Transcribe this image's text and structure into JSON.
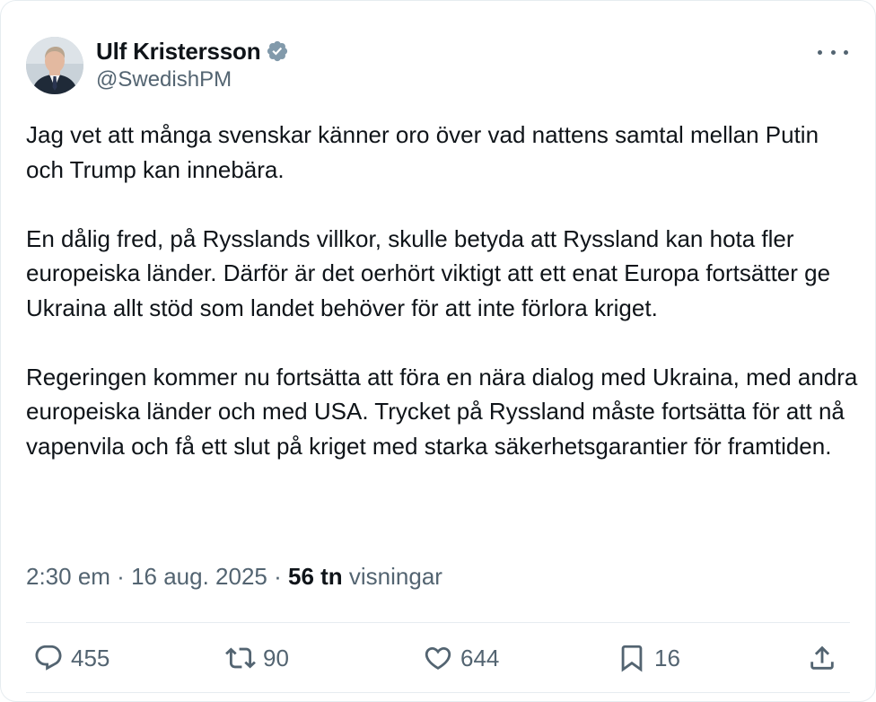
{
  "author": {
    "display_name": "Ulf Kristersson",
    "handle": "@SwedishPM",
    "verified_badge": "verified-badge-icon",
    "verified_color": "#829aab"
  },
  "tweet": {
    "paragraphs": [
      "Jag vet att många svenskar känner oro över vad nattens samtal mellan Putin och Trump kan innebära.",
      "En dålig fred, på Rysslands villkor, skulle betyda att Ryssland kan hota fler europeiska länder. Därför är det oerhört viktigt att ett enat Europa fortsätter ge Ukraina allt stöd som landet behöver för att inte förlora kriget.",
      "Regeringen kommer nu fortsätta att föra en nära dialog med Ukraina, med andra europeiska länder och med USA. Trycket på Ryssland måste fortsätta för att nå vapenvila och få ett slut på kriget med starka säkerhetsgarantier för framtiden."
    ]
  },
  "meta": {
    "time": "2:30 em",
    "separator": " · ",
    "date": "16 aug. 2025",
    "views_count": "56 tn",
    "views_label": "visningar"
  },
  "actions": {
    "replies": "455",
    "reposts": "90",
    "likes": "644",
    "bookmarks": "16"
  },
  "colors": {
    "text": "#0f1419",
    "secondary": "#536471",
    "divider": "#e6ecf0"
  }
}
